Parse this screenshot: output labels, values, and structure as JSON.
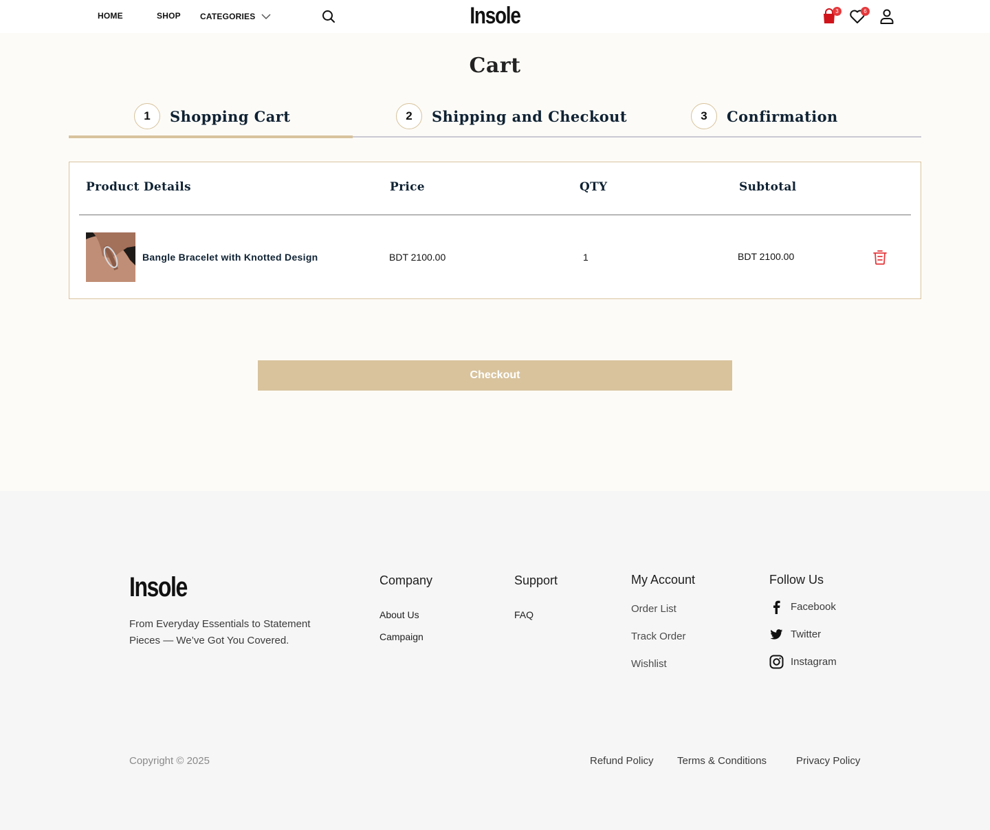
{
  "header": {
    "nav": {
      "home": "HOME",
      "shop": "SHOP",
      "categories": "CATEGORIES"
    },
    "logo": "Insole",
    "cart_count": "3",
    "wishlist_count": "6"
  },
  "page_title": "Cart",
  "steps": [
    {
      "num": "1",
      "label": "Shopping Cart"
    },
    {
      "num": "2",
      "label": "Shipping and Checkout"
    },
    {
      "num": "3",
      "label": "Confirmation"
    }
  ],
  "table": {
    "headers": {
      "product": "Product Details",
      "price": "Price",
      "qty": "QTY",
      "subtotal": "Subtotal"
    },
    "rows": [
      {
        "name": "Bangle Bracelet with Knotted Design",
        "price": "BDT 2100.00",
        "qty": "1",
        "subtotal": "BDT 2100.00"
      }
    ]
  },
  "checkout_label": "Checkout",
  "footer": {
    "logo": "Insole",
    "tagline": "From Everyday Essentials to Statement Pieces — We’ve Got You Covered.",
    "company": {
      "title": "Company",
      "links": [
        "About Us",
        "Campaign"
      ]
    },
    "support": {
      "title": "Support",
      "links": [
        "FAQ"
      ]
    },
    "account": {
      "title": "My Account",
      "links": [
        "Order List",
        "Track Order",
        "Wishlist"
      ]
    },
    "follow": {
      "title": "Follow Us",
      "links": [
        "Facebook",
        "Twitter",
        "Instagram"
      ]
    },
    "copyright": "Copyright © 2025",
    "policies": [
      "Refund Policy",
      "Terms & Conditions",
      "Privacy Policy"
    ]
  },
  "colors": {
    "accent": "#d8c39d",
    "text": "#0f2233",
    "danger": "#e5383b",
    "footer_bg": "#f6f6f6",
    "page_bg": "#fdfbf7"
  }
}
